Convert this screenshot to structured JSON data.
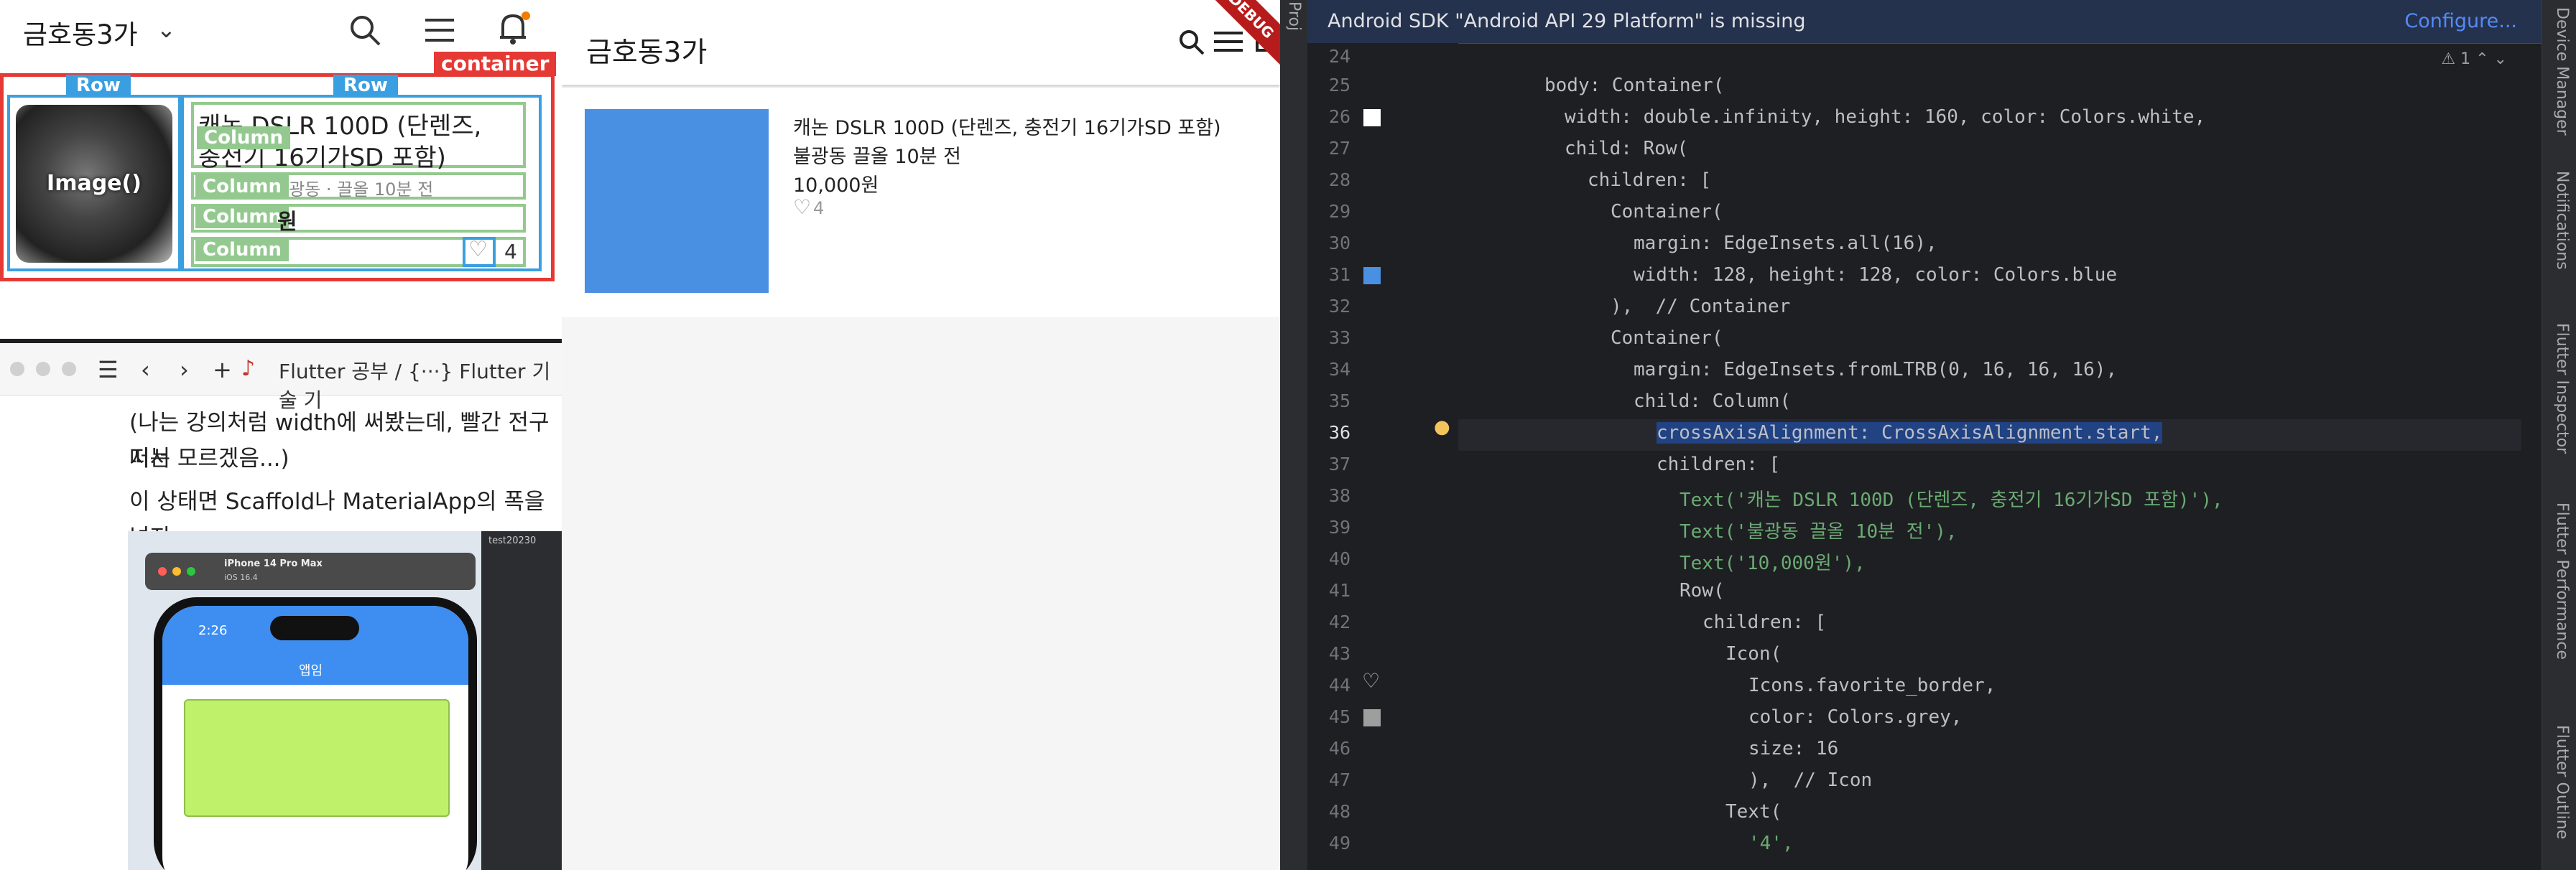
{
  "left_top": {
    "app_title": "금호동3가",
    "chevron": "chevron-down-icon",
    "labels": {
      "row1": "Row",
      "row2": "Row",
      "container": "container",
      "image": "Image()",
      "column1": "Column",
      "column2": "Column",
      "column3": "Column",
      "column4": "Column"
    },
    "product": {
      "title_line1": "캐논 DSLR 100D (단렌즈,",
      "title_line2": "충전기 16기가SD 포함)",
      "location": "불광동 · 끌올 10분 전",
      "price_suffix": "원",
      "likes": "4"
    }
  },
  "browser": {
    "tab_text": "Flutter 공부 / {···} Flutter 기술 기",
    "para1_line1": "(나는 강의처럼 width에 써봤는데, 빨간 전구 떠서",
    "para1_line2": "지는 모르겠음...)",
    "para2": "이 상태면 Scaffold나 MaterialApp의 폭을 넘지"
  },
  "embedded_shot": {
    "device_name": "iPhone 14 Pro Max",
    "device_os": "iOS 16.4",
    "time": "2:26",
    "app_bar_title": "앱임",
    "ide_tab": "test20230"
  },
  "middle_app": {
    "title": "금호동3가",
    "debug_banner": "DEBUG",
    "product_title": "캐논 DSLR 100D (단렌즈, 충전기 16기가SD 포함)",
    "product_location": "불광동 끌올 10분 전",
    "product_price": "10,000원",
    "product_likes": "4",
    "box_color": "#4a90e2"
  },
  "ide": {
    "banner_message": "Android SDK \"Android API 29 Platform\" is missing",
    "banner_action": "Configure...",
    "left_strip_label": "Proj",
    "warning_count": "1",
    "right_tools": [
      "Device Manager",
      "Notifications",
      "Flutter Inspector",
      "Flutter Performance",
      "Flutter Outline"
    ],
    "current_line": "36",
    "lines": [
      {
        "n": "24",
        "text": ""
      },
      {
        "n": "25",
        "text": "body: Container("
      },
      {
        "n": "26",
        "text": "width: double.infinity, height: 160, color: Colors.white,"
      },
      {
        "n": "27",
        "text": "child: Row("
      },
      {
        "n": "28",
        "text": "children: ["
      },
      {
        "n": "29",
        "text": "Container("
      },
      {
        "n": "30",
        "text": "margin: EdgeInsets.all(16),"
      },
      {
        "n": "31",
        "text": "width: 128, height: 128, color: Colors.blue"
      },
      {
        "n": "32",
        "text": "),  // Container"
      },
      {
        "n": "33",
        "text": "Container("
      },
      {
        "n": "34",
        "text": "margin: EdgeInsets.fromLTRB(0, 16, 16, 16),"
      },
      {
        "n": "35",
        "text": "child: Column("
      },
      {
        "n": "36",
        "text": "crossAxisAlignment: CrossAxisAlignment.start,"
      },
      {
        "n": "37",
        "text": "children: ["
      },
      {
        "n": "38",
        "text": "Text('캐논 DSLR 100D (단렌즈, 충전기 16기가SD 포함)'),"
      },
      {
        "n": "39",
        "text": "Text('불광동 끌올 10분 전'),"
      },
      {
        "n": "40",
        "text": "Text('10,000원'),"
      },
      {
        "n": "41",
        "text": "Row("
      },
      {
        "n": "42",
        "text": "children: ["
      },
      {
        "n": "43",
        "text": "Icon("
      },
      {
        "n": "44",
        "text": "Icons.favorite_border,"
      },
      {
        "n": "45",
        "text": "color: Colors.grey,"
      },
      {
        "n": "46",
        "text": "size: 16"
      },
      {
        "n": "47",
        "text": "),  // Icon"
      },
      {
        "n": "48",
        "text": "Text("
      },
      {
        "n": "49",
        "text": "'4',"
      }
    ]
  },
  "colors": {
    "accent_red": "#e53935",
    "debug_blue": "#3a9fe0",
    "debug_green": "#93c98e",
    "ide_bg": "#1e1f22"
  }
}
